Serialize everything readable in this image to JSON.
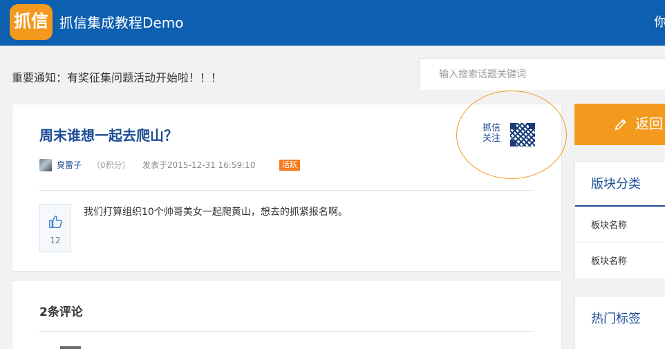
{
  "header": {
    "logo_text": "抓信",
    "app_title": "抓信集成教程Demo",
    "user_peek": "你"
  },
  "notice": "重要通知：有奖征集问题活动开始啦！！！",
  "search": {
    "placeholder": "输入搜索话题关键词",
    "value": ""
  },
  "post": {
    "title": "周末谁想一起去爬山？",
    "author": "臭雷子",
    "points": "（0积分）",
    "posted": "发表于2015-12-31 16:59:10",
    "badge": "活跃",
    "body": "我们打算组织10个帅哥美女一起爬黄山，想去的抓紧报名啊。",
    "likes": "12"
  },
  "qr": {
    "line1": "抓信",
    "line2": "关注"
  },
  "comments": {
    "title": "2条评论"
  },
  "sidebar": {
    "back_label": "返回",
    "categories_title": "版块分类",
    "category_items": [
      "板块名称",
      "板块名称"
    ],
    "tags_title": "热门标签"
  },
  "colors": {
    "header_bg": "#0d5fb0",
    "accent_orange": "#f39a1e",
    "link_blue": "#1a4c94",
    "badge_orange": "#f47c20"
  },
  "icons": {
    "like": "thumbs-up-icon",
    "back": "pencil-icon",
    "qr": "qr-code-icon"
  }
}
